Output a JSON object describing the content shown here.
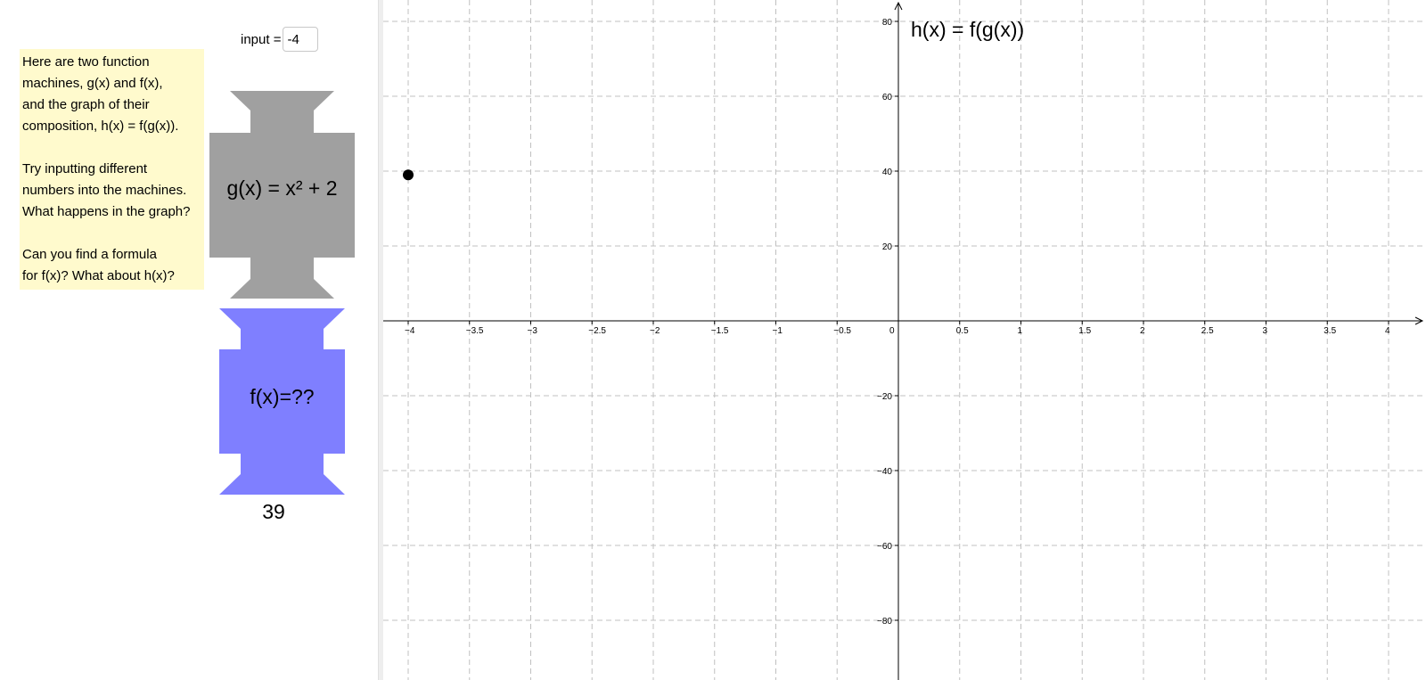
{
  "input": {
    "label": "input =",
    "value": "-4"
  },
  "instructions": {
    "paragraphs": [
      [
        "Here are two function",
        "machines, g(x) and f(x),",
        "and the graph of their",
        "composition, h(x) = f(g(x))."
      ],
      [
        "Try inputting different",
        "numbers into the machines.",
        "What happens in the graph?"
      ],
      [
        "Can you find a formula",
        "for f(x)? What about h(x)?"
      ]
    ]
  },
  "machines": {
    "g": {
      "label": "g(x) = x² + 2",
      "color": "#a0a0a0"
    },
    "f": {
      "label": "f(x)=??",
      "color": "#7f7fff"
    }
  },
  "output": {
    "value": "39"
  },
  "graph": {
    "title": "h(x) = f(g(x))",
    "axis_color": "#000000",
    "grid_color": "#c0c0c0"
  },
  "chart_data": {
    "type": "scatter",
    "title": "h(x) = f(g(x))",
    "xlabel": "",
    "ylabel": "",
    "xlim": [
      -4.2,
      4.3
    ],
    "ylim": [
      -95,
      85
    ],
    "x_ticks": [
      -4,
      -3.5,
      -3,
      -2.5,
      -2,
      -1.5,
      -1,
      -0.5,
      0,
      0.5,
      1,
      1.5,
      2,
      2.5,
      3,
      3.5,
      4
    ],
    "x_tick_labels": [
      "−4",
      "−3.5",
      "−3",
      "−2.5",
      "−2",
      "−1.5",
      "−1",
      "−0.5",
      "0",
      "0.5",
      "1",
      "1.5",
      "2",
      "2.5",
      "3",
      "3.5",
      "4"
    ],
    "y_ticks": [
      80,
      60,
      40,
      20,
      -20,
      -40,
      -60,
      -80
    ],
    "y_tick_labels": [
      "80",
      "60",
      "40",
      "20",
      "−20",
      "−40",
      "−60",
      "−80"
    ],
    "grid": true,
    "grid_style": "dashed",
    "points": [
      {
        "x": -4,
        "y": 39
      }
    ]
  }
}
